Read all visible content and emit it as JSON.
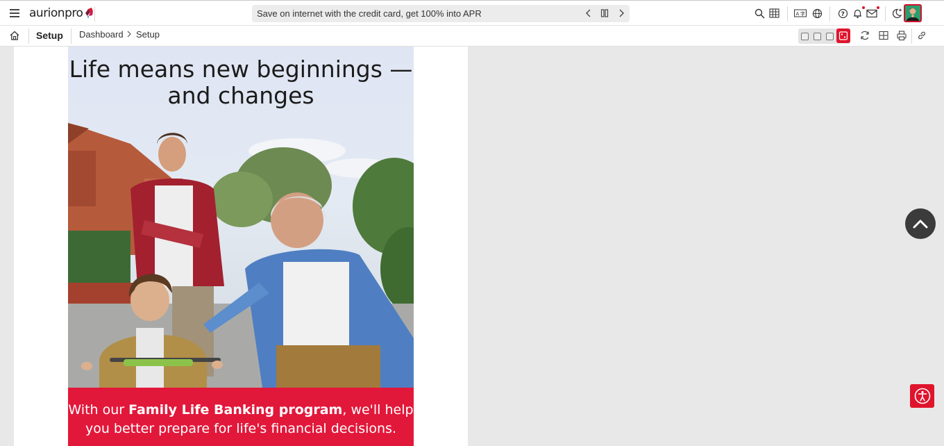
{
  "app": {
    "logo_text": "aurionpro",
    "brand_color": "#e0142d"
  },
  "ticker": {
    "message": "Save on internet with the credit card, get 100% into APR"
  },
  "header_icons": [
    "menu-icon",
    "search-icon",
    "grid-icon",
    "translate-icon",
    "globe-icon",
    "help-icon",
    "bell-icon",
    "mail-icon",
    "theme-toggle-icon",
    "avatar"
  ],
  "subbar": {
    "page_title": "Setup",
    "breadcrumb": [
      "Dashboard",
      "Setup"
    ]
  },
  "banner": {
    "title_line1": "Life means new beginnings —",
    "title_line2": "and changes",
    "footer_prefix": "With our ",
    "footer_bold": "Family Life Banking program",
    "footer_suffix": ", we'll help",
    "footer_line2": "you better prepare for life's financial decisions."
  }
}
